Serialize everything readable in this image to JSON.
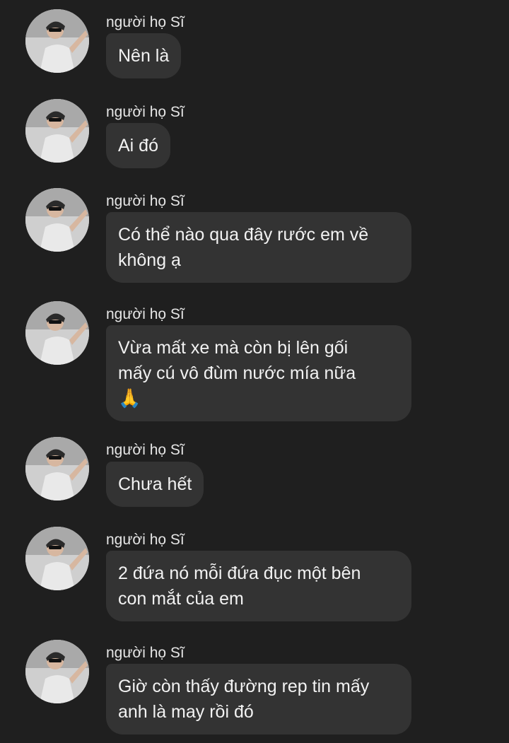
{
  "messages": [
    {
      "sender": "người họ Sĩ",
      "lines": [
        "Nên là"
      ]
    },
    {
      "sender": "người họ Sĩ",
      "lines": [
        "Ai đó"
      ]
    },
    {
      "sender": "người họ Sĩ",
      "lines": [
        "Có thể nào qua đây rước em về",
        "không ạ"
      ]
    },
    {
      "sender": "người họ Sĩ",
      "lines": [
        "Vừa mất xe mà còn bị lên gối",
        "mấy cú vô đùm nước mía nữa"
      ],
      "emoji": "🙏",
      "emoji_icon": "folded-hands-icon"
    },
    {
      "sender": "người họ Sĩ",
      "lines": [
        "Chưa hết"
      ]
    },
    {
      "sender": "người họ Sĩ",
      "lines": [
        "2 đứa nó mỗi đứa đục một bên",
        "con mắt của em"
      ]
    },
    {
      "sender": "người họ Sĩ",
      "lines": [
        "Giờ còn thấy đường rep tin mấy",
        "anh là may rồi đó"
      ]
    }
  ],
  "colors": {
    "background": "#1f1f1f",
    "bubble": "#333333",
    "text": "#f2f2f2"
  }
}
